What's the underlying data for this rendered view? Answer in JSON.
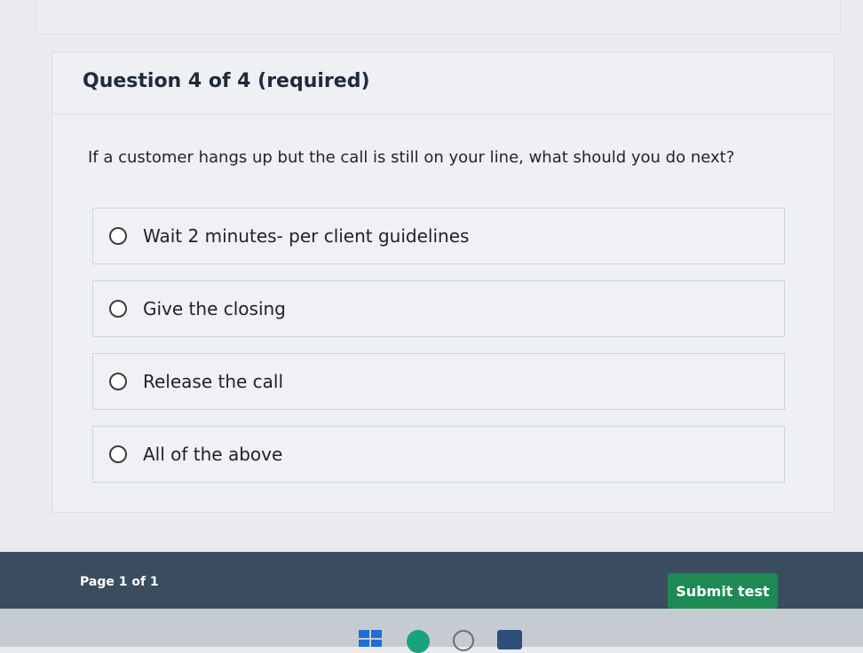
{
  "question": {
    "title": "Question 4 of 4 (required)",
    "text": "If a customer hangs up but the call is still on your line, what should you do next?",
    "options": [
      {
        "label": "Wait 2 minutes- per client guidelines"
      },
      {
        "label": "Give the closing"
      },
      {
        "label": "Release the call"
      },
      {
        "label": "All of the above"
      }
    ]
  },
  "footer": {
    "page_info": "Page 1 of 1",
    "submit_label": "Submit test"
  },
  "taskbar": {
    "icons": [
      "windows-start-icon",
      "edge-browser-icon",
      "search-icon",
      "store-icon"
    ]
  },
  "colors": {
    "footer_bg": "#3a4d5e",
    "submit_bg": "#1d8a53"
  }
}
